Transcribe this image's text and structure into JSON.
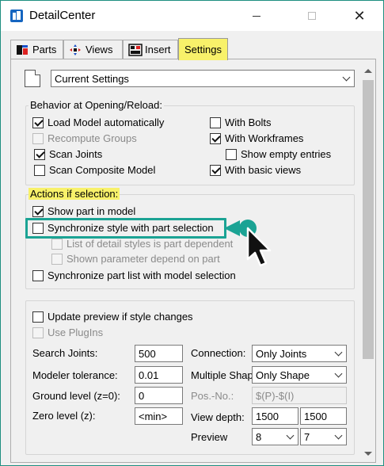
{
  "window": {
    "title": "DetailCenter"
  },
  "titlebar": {
    "minimize": "—",
    "maximize": "☐",
    "close": "✕"
  },
  "tabs": [
    {
      "label": "Parts",
      "icon": "parts-icon"
    },
    {
      "label": "Views",
      "icon": "views-icon"
    },
    {
      "label": "Insert",
      "icon": "insert-icon"
    },
    {
      "label": "Settings",
      "icon": ""
    }
  ],
  "settings_select": {
    "value": "Current Settings"
  },
  "behavior": {
    "title": "Behavior at Opening/Reload:",
    "load_model": {
      "label": "Load Model automatically",
      "checked": true
    },
    "recompute_groups": {
      "label": "Recompute Groups",
      "checked": false
    },
    "scan_joints": {
      "label": "Scan Joints",
      "checked": true
    },
    "scan_composite": {
      "label": "Scan Composite Model",
      "checked": false
    },
    "with_bolts": {
      "label": "With Bolts",
      "checked": false
    },
    "with_workframes": {
      "label": "With Workframes",
      "checked": true
    },
    "show_empty": {
      "label": "Show empty entries",
      "checked": false
    },
    "with_basic_views": {
      "label": "With basic views",
      "checked": true
    }
  },
  "actions": {
    "title": "Actions if selection:",
    "show_part": {
      "label": "Show part in model",
      "checked": true
    },
    "sync_style": {
      "label": "Synchronize style with part selection",
      "checked": false
    },
    "list_dependent": {
      "label": "List of detail styles is part dependent",
      "checked": false
    },
    "shown_param": {
      "label": "Shown parameter depend on part",
      "checked": false
    },
    "sync_partlist": {
      "label": "Synchronize part list with model selection",
      "checked": false
    }
  },
  "preview": {
    "update_preview": {
      "label": "Update preview if style changes",
      "checked": false
    },
    "use_plugins": {
      "label": "Use PlugIns",
      "checked": false
    },
    "search_joints": {
      "label": "Search Joints:",
      "value": "500"
    },
    "modeler_tolerance": {
      "label": "Modeler tolerance:",
      "value": "0.01"
    },
    "ground_level": {
      "label": "Ground level (z=0):",
      "value": "0"
    },
    "zero_level": {
      "label": "Zero level (z):",
      "value": "<min>"
    },
    "connection": {
      "label": "Connection:",
      "value": "Only Joints"
    },
    "multiple_shapes": {
      "label": "Multiple Shap",
      "value": "Only Shape"
    },
    "pos_no": {
      "label": "Pos.-No.:",
      "value": "$(P)-$(I)"
    },
    "view_depth": {
      "label": "View depth:",
      "value1": "1500",
      "value2": "1500"
    },
    "preview_sel": {
      "label": "Preview",
      "value1": "8",
      "value2": "7"
    }
  }
}
